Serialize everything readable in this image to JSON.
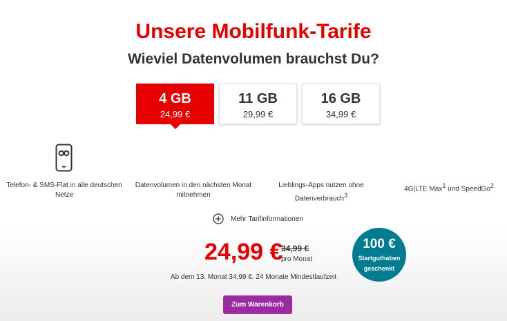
{
  "header": {
    "title": "Unsere Mobilfunk-Tarife",
    "subtitle": "Wieviel Datenvolumen brauchst Du?"
  },
  "tariffs": [
    {
      "volume": "4 GB",
      "price": "24,99 €",
      "selected": true
    },
    {
      "volume": "11 GB",
      "price": "29,99 €",
      "selected": false
    },
    {
      "volume": "16 GB",
      "price": "34,99 €",
      "selected": false
    }
  ],
  "features": [
    {
      "icon": "phone-infinity-icon",
      "line1": "Telefon- & SMS-Flat in alle deutschen",
      "line2": "Netze"
    },
    {
      "line1": "Datenvolumen in den nächsten Monat",
      "line2": "mitnehmen"
    },
    {
      "line1": "Lieblings-Apps nutzen ohne",
      "line2": "Datenverbrauch",
      "sup": "3"
    },
    {
      "line1": "4G|LTE Max",
      "sup1": "1",
      "line1b": " und SpeedGo",
      "sup2": "2"
    }
  ],
  "more_info": {
    "icon": "plus-circle-icon",
    "label": "Mehr Tarifinformationen"
  },
  "pricing": {
    "price": "24,99 €",
    "old_price": "34,99 €",
    "per_month": "pro Monat",
    "terms": "Ab dem 13. Monat 34,99 €. 24 Monate Mindestlaufzeit"
  },
  "bonus": {
    "amount": "100 €",
    "line1": "Startguthaben",
    "line2": "geschenkt"
  },
  "cart": {
    "label": "Zum Warenkorb"
  },
  "colors": {
    "brand_red": "#e60000",
    "teal": "#007c92",
    "purple": "#9c2aa0"
  }
}
